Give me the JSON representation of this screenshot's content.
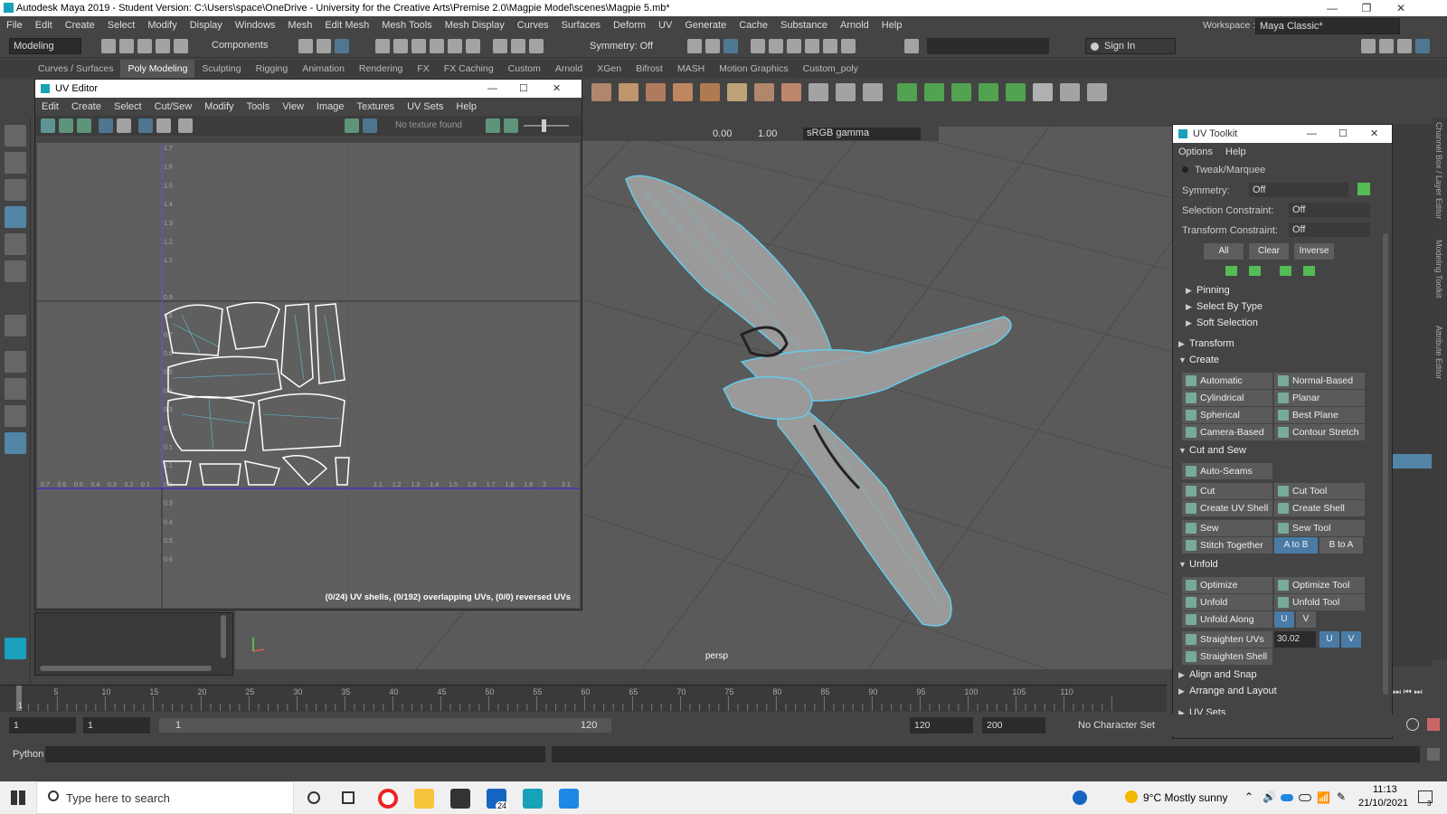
{
  "window": {
    "title": "Autodesk Maya 2019 - Student Version: C:\\Users\\space\\OneDrive - University for the Creative Arts\\Premise 2.0\\Magpie Model\\scenes\\Magpie 5.mb*"
  },
  "menu": [
    "File",
    "Edit",
    "Create",
    "Select",
    "Modify",
    "Display",
    "Windows",
    "Mesh",
    "Edit Mesh",
    "Mesh Tools",
    "Mesh Display",
    "Curves",
    "Surfaces",
    "Deform",
    "UV",
    "Generate",
    "Cache",
    "Substance",
    "Arnold",
    "Help"
  ],
  "workspace": {
    "label": "Workspace :",
    "value": "Maya Classic*"
  },
  "statusline": {
    "mode": "Modeling",
    "components": "Components",
    "symmetry": "Symmetry: Off",
    "signin": "Sign In"
  },
  "shelf_tabs": [
    "Curves / Surfaces",
    "Poly Modeling",
    "Sculpting",
    "Rigging",
    "Animation",
    "Rendering",
    "FX",
    "FX Caching",
    "Custom",
    "Arnold",
    "XGen",
    "Bifrost",
    "MASH",
    "Motion Graphics",
    "Custom_poly"
  ],
  "viewport": {
    "label": "persp",
    "exposure": "0.00",
    "gamma": "1.00",
    "colorspace": "sRGB gamma"
  },
  "uv_editor": {
    "title": "UV Editor",
    "menu": [
      "Edit",
      "Create",
      "Select",
      "Cut/Sew",
      "Modify",
      "Tools",
      "View",
      "Image",
      "Textures",
      "UV Sets",
      "Help"
    ],
    "texture": "No texture found",
    "status": "(0/24) UV shells, (0/192) overlapping UVs, (0/0) reversed UVs",
    "vticks": [
      "1.7",
      "1.6",
      "1.5",
      "1.4",
      "1.3",
      "1.2",
      "1.1",
      "0.9",
      "0.8",
      "0.7",
      "0.6",
      "0.5",
      "0.4",
      "0.3",
      "0.2",
      "0.1",
      "0.1",
      "0.2",
      "0.3",
      "0.4",
      "0.5",
      "0.6"
    ],
    "hticks": [
      "0.7",
      "0.6",
      "0.5",
      "0.4",
      "0.3",
      "0.2",
      "0.1",
      "1.1",
      "1.2",
      "1.3",
      "1.4",
      "1.5",
      "1.6",
      "1.7",
      "1.8",
      "1.9",
      "2",
      "2.1"
    ]
  },
  "uv_toolkit": {
    "title": "UV Toolkit",
    "menu": [
      "Options",
      "Help"
    ],
    "mode": "Tweak/Marquee",
    "symmetry": {
      "label": "Symmetry:",
      "value": "Off"
    },
    "sel_constraint": {
      "label": "Selection Constraint:",
      "value": "Off"
    },
    "trans_constraint": {
      "label": "Transform Constraint:",
      "value": "Off"
    },
    "sel_buttons": [
      "All",
      "Clear",
      "Inverse"
    ],
    "subsections": [
      "Pinning",
      "Select By Type",
      "Soft Selection"
    ],
    "transform": "Transform",
    "create": {
      "title": "Create",
      "items": [
        "Automatic",
        "Normal-Based",
        "Cylindrical",
        "Planar",
        "Spherical",
        "Best Plane",
        "Camera-Based",
        "Contour Stretch"
      ]
    },
    "cutsew": {
      "title": "Cut and Sew",
      "autoseams": "Auto-Seams",
      "items": [
        "Cut",
        "Cut Tool",
        "Create UV Shell",
        "Create Shell (Grid)",
        "Sew",
        "Sew Tool"
      ],
      "stitch": "Stitch Together",
      "atob": "A to B",
      "btoa": "B to A"
    },
    "unfold": {
      "title": "Unfold",
      "items": [
        "Optimize",
        "Optimize Tool",
        "Unfold",
        "Unfold Tool"
      ],
      "along": "Unfold Along",
      "u": "U",
      "v": "V",
      "straighten": "Straighten UVs",
      "angle": "30.02",
      "shell": "Straighten Shell"
    },
    "align": "Align and Snap",
    "arrange": "Arrange and Layout",
    "uvsets": "UV Sets"
  },
  "side_tabs": [
    "Channel Box / Layer Editor",
    "Modeling Toolkit",
    "Attribute Editor"
  ],
  "timeline": {
    "ticks": [
      "5",
      "10",
      "15",
      "20",
      "25",
      "30",
      "35",
      "40",
      "45",
      "50",
      "55",
      "60",
      "65",
      "70",
      "75",
      "80",
      "85",
      "90",
      "95",
      "100",
      "105",
      "110"
    ],
    "current": "1"
  },
  "range": {
    "start": "1",
    "current": "1",
    "slider_start": "1",
    "slider_end": "120",
    "end": "120",
    "max": "200",
    "charset": "No Character Set"
  },
  "cmd": {
    "label": "Python"
  },
  "taskbar": {
    "search": "Type here to search",
    "weather": "9°C  Mostly sunny",
    "time": "11:13",
    "date": "21/10/2021",
    "badge": "24",
    "notif": "3"
  }
}
